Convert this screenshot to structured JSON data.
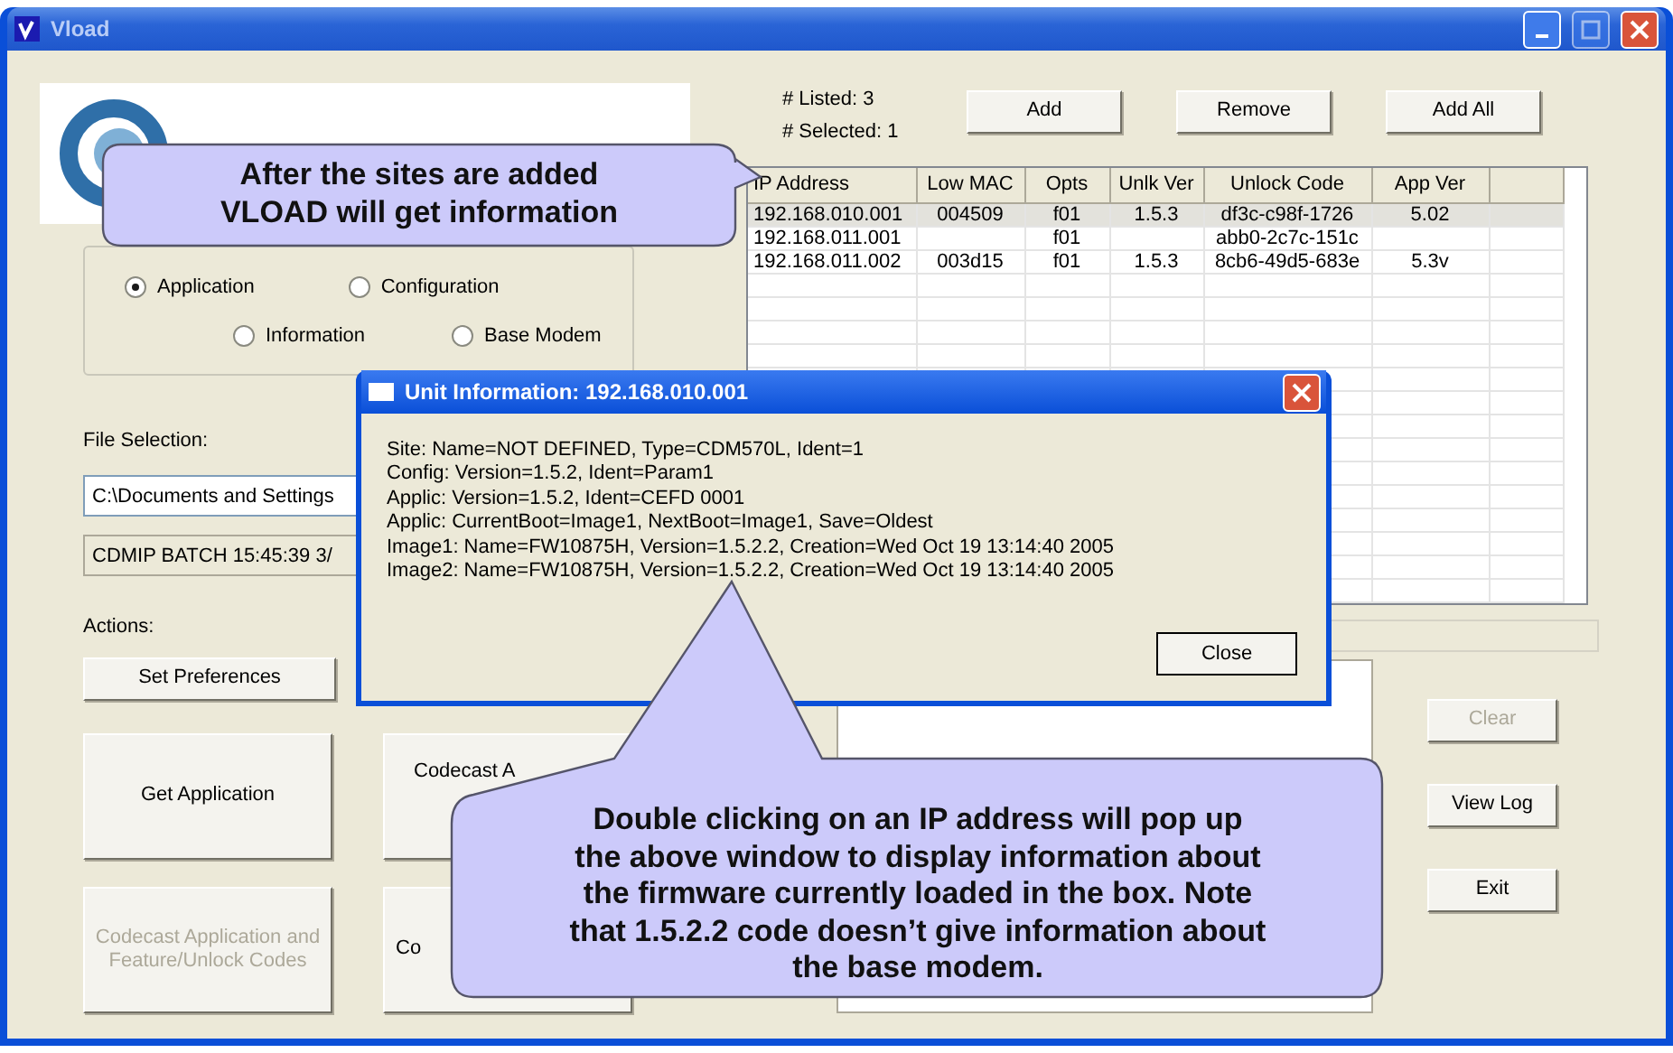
{
  "window": {
    "title": "Vload"
  },
  "mode_selection": {
    "options": [
      {
        "label": "Application",
        "selected": true
      },
      {
        "label": "Configuration",
        "selected": false
      },
      {
        "label": "Information",
        "selected": false
      },
      {
        "label": "Base Modem",
        "selected": false
      }
    ]
  },
  "file_selection": {
    "label": "File Selection:",
    "fields": [
      {
        "value": "C:\\Documents and Settings"
      },
      {
        "value": "CDMIP BATCH 15:45:39 3/"
      }
    ]
  },
  "actions": {
    "label": "Actions:",
    "preferences_button": "Set Preferences",
    "buttons": [
      {
        "label": "Get Application",
        "disabled": false
      },
      {
        "label": "Codecast A",
        "disabled": false
      },
      {
        "label": "Codecast Application and Feature/Unlock Codes",
        "disabled": true
      },
      {
        "label": "Co",
        "disabled": false
      }
    ]
  },
  "site_list": {
    "listed": "# Listed: 3",
    "selected_count": "# Selected: 1",
    "buttons": [
      "Add",
      "Remove",
      "Add All"
    ],
    "columns": [
      "IP Address",
      "Low MAC",
      "Opts",
      "Unlk Ver",
      "Unlock Code",
      "App Ver"
    ],
    "rows": [
      {
        "cells": [
          "192.168.010.001",
          "004509",
          "f01",
          "1.5.3",
          "df3c-c98f-1726",
          "5.02"
        ],
        "selected": true
      },
      {
        "cells": [
          "192.168.011.001",
          "",
          "f01",
          "",
          "abb0-2c7c-151c",
          ""
        ],
        "selected": false
      },
      {
        "cells": [
          "192.168.011.002",
          "003d15",
          "f01",
          "1.5.3",
          "8cb6-49d5-683e",
          "5.3v"
        ],
        "selected": false
      }
    ]
  },
  "side_buttons": [
    {
      "label": "Clear",
      "disabled": true
    },
    {
      "label": "View Log",
      "disabled": false
    },
    {
      "label": "Exit",
      "disabled": false
    }
  ],
  "dialog": {
    "title": "Unit Information: 192.168.010.001",
    "lines": [
      "Site: Name=NOT DEFINED, Type=CDM570L, Ident=1",
      "Config: Version=1.5.2, Ident=Param1",
      "Applic: Version=1.5.2, Ident=CEFD 0001",
      "Applic: CurrentBoot=Image1, NextBoot=Image1, Save=Oldest",
      "Image1: Name=FW10875H, Version=1.5.2.2, Creation=Wed Oct 19 13:14:40 2005",
      "Image2: Name=FW10875H, Version=1.5.2.2, Creation=Wed Oct 19 13:14:40 2005"
    ],
    "button": "Close"
  },
  "callouts": [
    {
      "text": "After the sites are added\nVLOAD will get information"
    },
    {
      "text": "Double clicking on an IP address will pop up\nthe above window to display information about\nthe firmware currently loaded in the box.  Note\nthat 1.5.2.2 code doesn’t give information about\nthe base modem."
    }
  ]
}
